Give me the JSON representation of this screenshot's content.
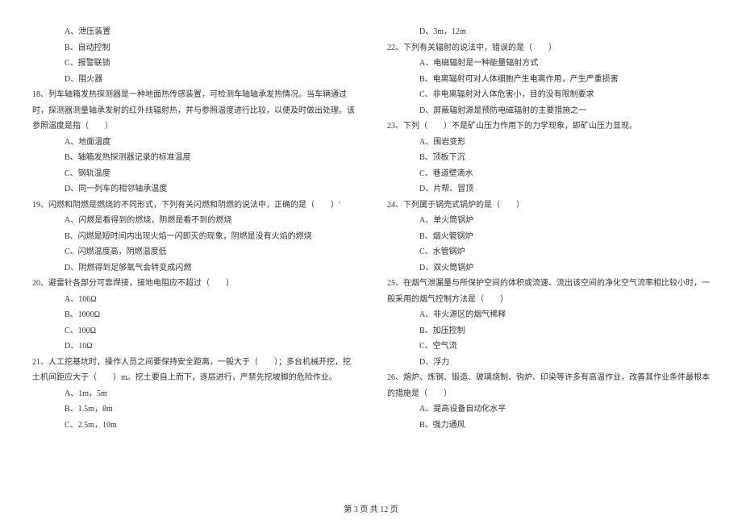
{
  "left_column": {
    "q_options_top": [
      "A、泄压装置",
      "B、自动控制",
      "C、报警联锁",
      "D、阻火器"
    ],
    "q18": "18、列车轴箱发热探测器是一种地面热传感装置，可检测车轴轴承发热情况。当车辆通过时，探测器测量轴承发射的红外线辐射热，并与参照温度进行比较，以便及时做出处理。该参照温度是指（　　）",
    "q18_options": [
      "A、地面温度",
      "B、轴箱发热探测器记录的标准温度",
      "C、钢轨温度",
      "D、同一列车的相邻轴承温度"
    ],
    "q19": "19、闪燃和阴燃是燃烧的不同形式，下列有关闪燃和阴燃的说法中，正确的是（　　）'",
    "q19_options": [
      "A、闪燃是看得到的燃烧，阴燃是看不到的燃烧",
      "B、闪燃是短时间内出现火焰一闪即灭的现象，阴燃是没有火焰的燃烧",
      "C、闪燃温度高，阴燃温度低",
      "D、阴燃得到足够氧气会转变成闪燃"
    ],
    "q20": "20、避雷针各部分可靠焊接，接地电阻应不超过（　　）",
    "q20_options": [
      "A、106Ω",
      "B、1000Ω",
      "C、100Ω",
      "D、10Ω"
    ],
    "q21": "21、人工挖基坑时，操作人员之间要保持安全距离，一般大于（　　）；多台机械开挖，挖土机间距应大于（　　）m。挖土要自上而下，逐层进行，严禁先挖坡脚的危险作业。",
    "q21_options": [
      "A、1m，5m",
      "B、1.5m，8m",
      "C、2.5m，10m"
    ]
  },
  "right_column": {
    "q21_opt_d": "D、3m，12m",
    "q22": "22、下列有关辐射的说法中，错误的是（　　）",
    "q22_options": [
      "A、电磁辐射是一种能量辐射方式",
      "B、电离辐射可对人体细胞产生电离作用，产生严重损害",
      "C、非电离辐射对人体危害小，目的没有限制要求",
      "D、屏蔽辐射源是预防电磁辐射的主要措施之一"
    ],
    "q23": "23、下列（　　）不是矿山压力作用下的力学现象，即矿山压力显现。",
    "q23_options": [
      "A、围岩变形",
      "B、顶板下沉",
      "C、巷道壁滴水",
      "D、片帮、冒顶"
    ],
    "q24": "24、下列属于锅壳式锅炉的是（　　）",
    "q24_options": [
      "A、单火筒锅炉",
      "B、烟火管锅炉",
      "C、水管锅炉",
      "D、双火筒锅炉"
    ],
    "q25": "25、在烟气泄漏量与所保护空间的体积或流速、流出该空间的净化空气流率相比较小时，一般采用的烟气控制方法是（　　）",
    "q25_options": [
      "A、非火源区的烟气稀释",
      "B、加压控制",
      "C、空气流",
      "D、浮力"
    ],
    "q26": "26、熔炉、炼钢、锻造、玻璃烧制、钩炉、印染等许多有高温作业，改善其作业条件最根本的措施是（　　）",
    "q26_options": [
      "A、提高设备自动化水平",
      "B、强力通风"
    ]
  },
  "footer": "第 3 页 共 12 页"
}
